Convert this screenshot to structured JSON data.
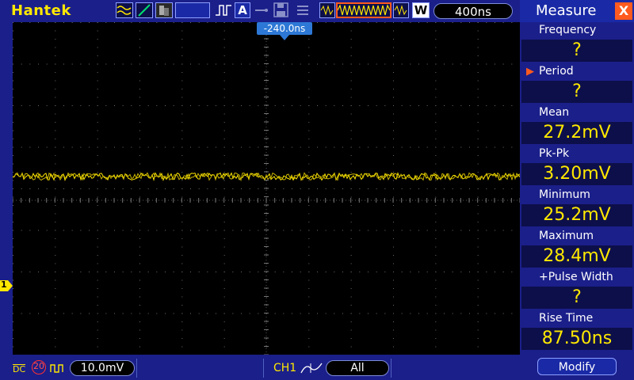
{
  "header": {
    "brand": "Hantek",
    "time_position": "-240.0ns",
    "timebase": "400ns",
    "memory_depth_label": "W"
  },
  "status_bar": {
    "coupling": "DC",
    "bw_limit": "20",
    "volts_div": "10.0mV",
    "trigger_source": "CH1",
    "trigger_mode": "All"
  },
  "channel_marker": "1",
  "measure_panel": {
    "title": "Measure",
    "close_label": "X",
    "items": [
      {
        "label": "Frequency",
        "value": "?"
      },
      {
        "label": "Period",
        "value": "?"
      },
      {
        "label": "Mean",
        "value": "27.2mV"
      },
      {
        "label": "Pk-Pk",
        "value": "3.20mV"
      },
      {
        "label": "Minimum",
        "value": "25.2mV"
      },
      {
        "label": "Maximum",
        "value": "28.4mV"
      },
      {
        "label": "+Pulse Width",
        "value": "?"
      },
      {
        "label": "Rise Time",
        "value": "87.50ns"
      }
    ],
    "modify_label": "Modify"
  },
  "colors": {
    "background": "#1b1f8a",
    "waveform": "#ffe800",
    "accent": "#ff5a1f"
  }
}
